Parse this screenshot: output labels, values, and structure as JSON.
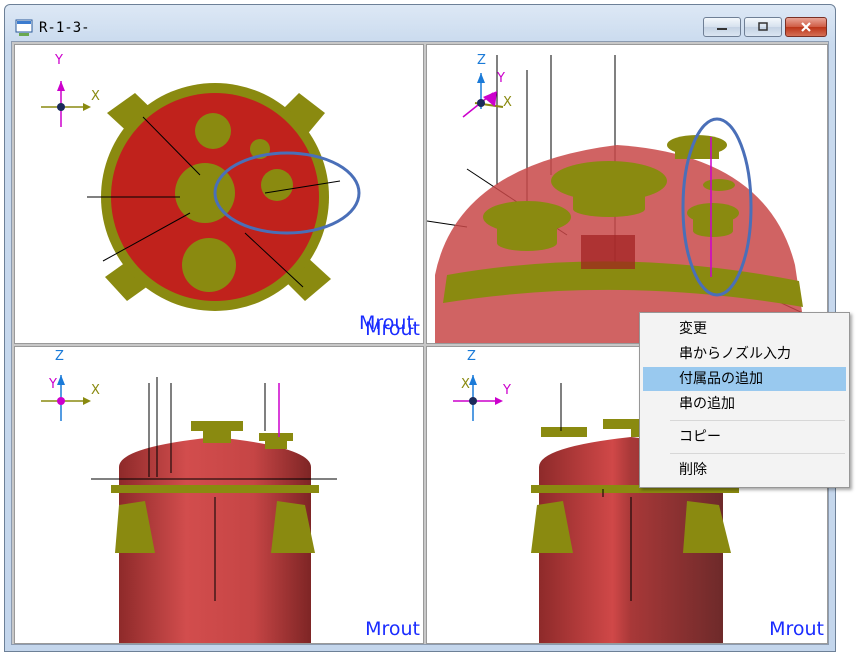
{
  "window": {
    "title": "R-1-3-",
    "buttons": {
      "minimize": "minimize",
      "maximize": "maximize",
      "close": "close"
    }
  },
  "viewports": [
    {
      "name": "top-view",
      "label": "Mrout",
      "axes": {
        "vertical": "Y",
        "horizontal": "X"
      }
    },
    {
      "name": "iso-view",
      "label": "Mrout",
      "axes": {
        "vertical": "Z",
        "secondary": "Y",
        "horizontal": "X"
      }
    },
    {
      "name": "front-view",
      "label": "Mrout",
      "axes": {
        "vertical": "Z",
        "secondary": "Y",
        "horizontal": "X"
      }
    },
    {
      "name": "side-view",
      "label": "Mrout",
      "axes": {
        "vertical": "Z",
        "secondary": "X",
        "horizontal": "Y"
      }
    }
  ],
  "context_menu": {
    "items": [
      {
        "label": "変更",
        "highlighted": false
      },
      {
        "label": "串からノズル入力",
        "highlighted": false
      },
      {
        "label": "付属品の追加",
        "highlighted": true
      },
      {
        "label": "串の追加",
        "highlighted": false
      },
      {
        "label": "コピー",
        "highlighted": false
      },
      {
        "label": "削除",
        "highlighted": false
      }
    ]
  },
  "colors": {
    "vessel_red": "#c0221c",
    "flange_olive": "#8a8a10",
    "annotation_blue": "#4a6fb8",
    "label_blue": "#1a2cff",
    "menu_highlight": "#99c9ef"
  }
}
